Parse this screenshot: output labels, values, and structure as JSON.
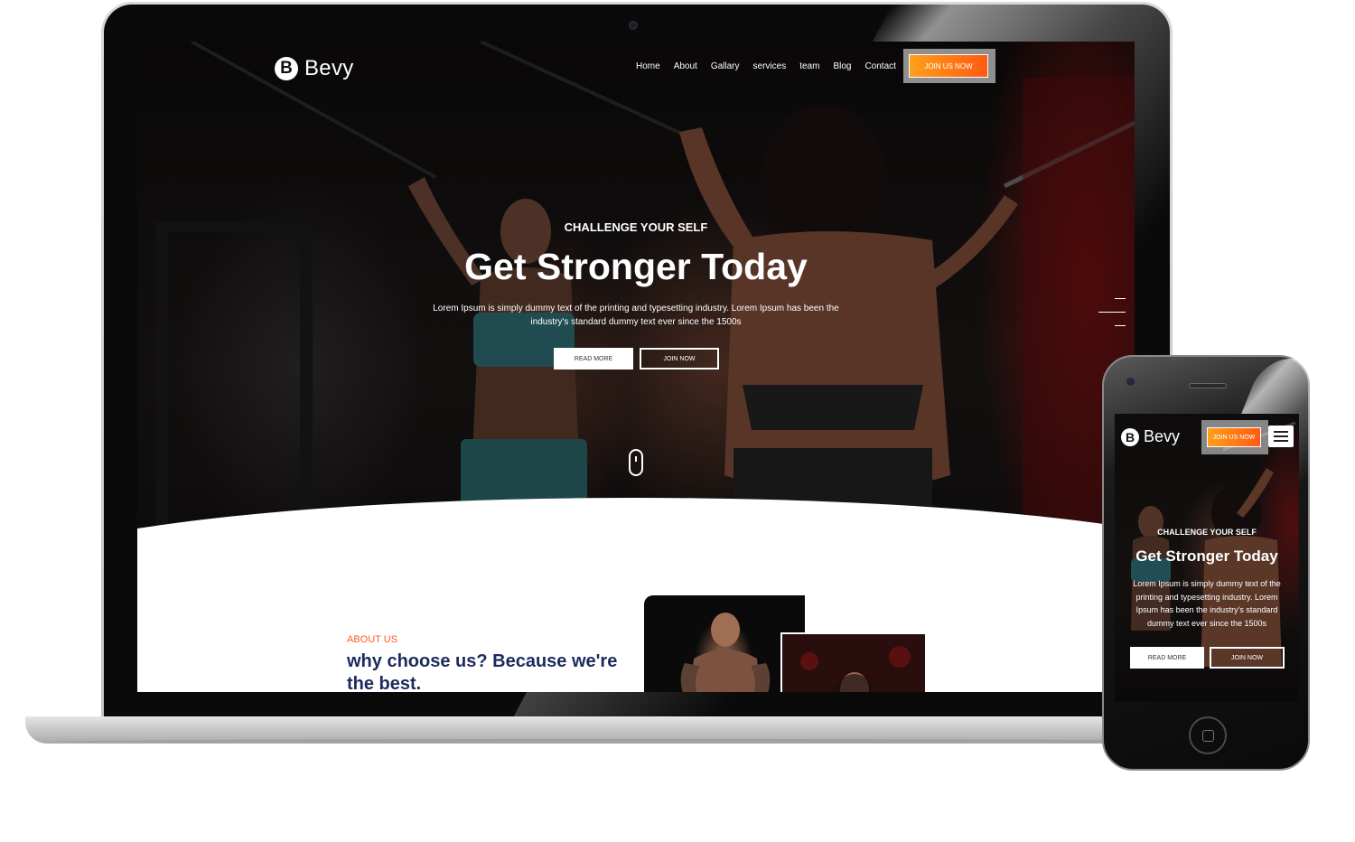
{
  "desktop": {
    "brand": {
      "mark": "B",
      "name": "Bevy"
    },
    "nav": [
      "Home",
      "About",
      "Gallary",
      "services",
      "team",
      "Blog",
      "Contact"
    ],
    "join_cta": "JOIN US NOW",
    "hero": {
      "subtitle": "CHALLENGE YOUR SELF",
      "title": "Get Stronger Today",
      "description": "Lorem Ipsum is simply dummy text of the printing and typesetting industry. Lorem Ipsum has been the industry's standard dummy text ever since the 1500s",
      "read_more": "READ MORE",
      "join_now": "JOIN NOW"
    },
    "about": {
      "label": "ABOUT US",
      "title": "why choose us? Because we're the best."
    }
  },
  "mobile": {
    "brand": {
      "mark": "B",
      "name": "Bevy"
    },
    "join_cta": "JOIN US NOW",
    "hero": {
      "subtitle": "CHALLENGE YOUR SELF",
      "title": "Get Stronger Today",
      "description": "Lorem Ipsum is simply dummy text of the printing and typesetting industry. Lorem Ipsum has been the industry's standard dummy text ever since the 1500s",
      "read_more": "READ MORE",
      "join_now": "JOIN NOW"
    }
  },
  "colors": {
    "accent_start": "#ff9f1a",
    "accent_end": "#ff5a12",
    "about_label": "#ff5a1f",
    "about_title": "#1d2a5d"
  },
  "icons": [
    "scroll-mouse-icon",
    "hamburger-menu-icon",
    "camera-icon",
    "home-button-icon"
  ]
}
